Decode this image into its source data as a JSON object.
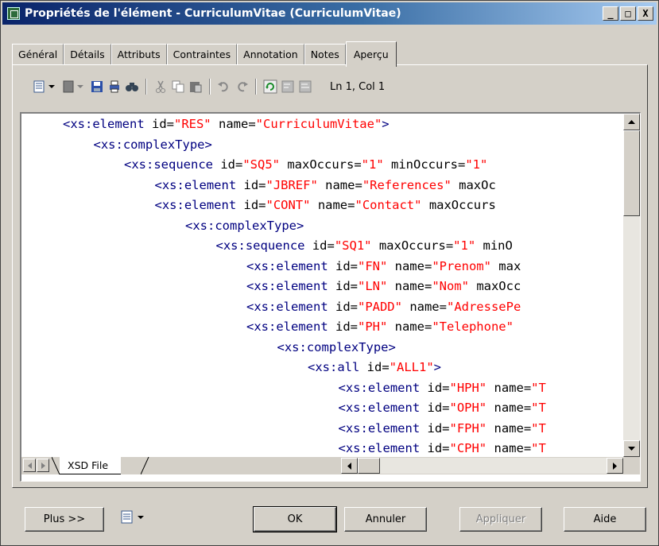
{
  "window": {
    "title": "Propriétés de l'élément - CurriculumVitae (CurriculumVitae)",
    "title_icon": "properties-window-icon",
    "controls": {
      "minimize": "_",
      "maximize": "□",
      "close": "X"
    }
  },
  "tabs": [
    {
      "label": "Général",
      "active": false
    },
    {
      "label": "Détails",
      "active": false
    },
    {
      "label": "Attributs",
      "active": false
    },
    {
      "label": "Contraintes",
      "active": false
    },
    {
      "label": "Annotation",
      "active": false
    },
    {
      "label": "Notes",
      "active": false
    },
    {
      "label": "Aperçu",
      "active": true
    }
  ],
  "toolbar": {
    "icons": [
      "properties-icon",
      "new-icon",
      "save-icon",
      "print-icon",
      "find-icon",
      "cut-icon",
      "copy-icon",
      "paste-icon",
      "undo-icon",
      "redo-icon",
      "refresh-icon",
      "collapse-icon",
      "expand-icon"
    ],
    "position_label": "Ln 1, Col 1"
  },
  "code": {
    "lines": [
      {
        "indent": 0,
        "parts": [
          [
            "t",
            "<xs:element "
          ],
          [
            "a",
            "id="
          ],
          [
            "v",
            "\"RES\""
          ],
          [
            "a",
            " name="
          ],
          [
            "v",
            "\"CurriculumVitae\""
          ],
          [
            "t",
            ">"
          ]
        ]
      },
      {
        "indent": 1,
        "parts": [
          [
            "t",
            "<xs:complexType>"
          ]
        ]
      },
      {
        "indent": 2,
        "parts": [
          [
            "t",
            "<xs:sequence "
          ],
          [
            "a",
            "id="
          ],
          [
            "v",
            "\"SQ5\""
          ],
          [
            "a",
            " maxOccurs="
          ],
          [
            "v",
            "\"1\""
          ],
          [
            "a",
            " minOccurs="
          ],
          [
            "v",
            "\"1\""
          ]
        ]
      },
      {
        "indent": 3,
        "parts": [
          [
            "t",
            "<xs:element "
          ],
          [
            "a",
            "id="
          ],
          [
            "v",
            "\"JBREF\""
          ],
          [
            "a",
            " name="
          ],
          [
            "v",
            "\"References\""
          ],
          [
            "a",
            " maxOc"
          ]
        ]
      },
      {
        "indent": 3,
        "parts": [
          [
            "t",
            "<xs:element "
          ],
          [
            "a",
            "id="
          ],
          [
            "v",
            "\"CONT\""
          ],
          [
            "a",
            " name="
          ],
          [
            "v",
            "\"Contact\""
          ],
          [
            "a",
            " maxOccurs"
          ]
        ]
      },
      {
        "indent": 4,
        "parts": [
          [
            "t",
            "<xs:complexType>"
          ]
        ]
      },
      {
        "indent": 5,
        "parts": [
          [
            "t",
            "<xs:sequence "
          ],
          [
            "a",
            "id="
          ],
          [
            "v",
            "\"SQ1\""
          ],
          [
            "a",
            " maxOccurs="
          ],
          [
            "v",
            "\"1\""
          ],
          [
            "a",
            " minO"
          ]
        ]
      },
      {
        "indent": 6,
        "parts": [
          [
            "t",
            "<xs:element "
          ],
          [
            "a",
            "id="
          ],
          [
            "v",
            "\"FN\""
          ],
          [
            "a",
            " name="
          ],
          [
            "v",
            "\"Prenom\""
          ],
          [
            "a",
            " max"
          ]
        ]
      },
      {
        "indent": 6,
        "parts": [
          [
            "t",
            "<xs:element "
          ],
          [
            "a",
            "id="
          ],
          [
            "v",
            "\"LN\""
          ],
          [
            "a",
            " name="
          ],
          [
            "v",
            "\"Nom\""
          ],
          [
            "a",
            " maxOcc"
          ]
        ]
      },
      {
        "indent": 6,
        "parts": [
          [
            "t",
            "<xs:element "
          ],
          [
            "a",
            "id="
          ],
          [
            "v",
            "\"PADD\""
          ],
          [
            "a",
            " name="
          ],
          [
            "v",
            "\"AdressePe"
          ]
        ]
      },
      {
        "indent": 6,
        "parts": [
          [
            "t",
            "<xs:element "
          ],
          [
            "a",
            "id="
          ],
          [
            "v",
            "\"PH\""
          ],
          [
            "a",
            " name="
          ],
          [
            "v",
            "\"Telephone\""
          ]
        ]
      },
      {
        "indent": 7,
        "parts": [
          [
            "t",
            "<xs:complexType>"
          ]
        ]
      },
      {
        "indent": 8,
        "parts": [
          [
            "t",
            "<xs:all "
          ],
          [
            "a",
            "id="
          ],
          [
            "v",
            "\"ALL1\""
          ],
          [
            "t",
            ">"
          ]
        ]
      },
      {
        "indent": 9,
        "parts": [
          [
            "t",
            "<xs:element "
          ],
          [
            "a",
            "id="
          ],
          [
            "v",
            "\"HPH\""
          ],
          [
            "a",
            " name="
          ],
          [
            "v",
            "\"T"
          ]
        ]
      },
      {
        "indent": 9,
        "parts": [
          [
            "t",
            "<xs:element "
          ],
          [
            "a",
            "id="
          ],
          [
            "v",
            "\"OPH\""
          ],
          [
            "a",
            " name="
          ],
          [
            "v",
            "\"T"
          ]
        ]
      },
      {
        "indent": 9,
        "parts": [
          [
            "t",
            "<xs:element "
          ],
          [
            "a",
            "id="
          ],
          [
            "v",
            "\"FPH\""
          ],
          [
            "a",
            " name="
          ],
          [
            "v",
            "\"T"
          ]
        ]
      },
      {
        "indent": 9,
        "parts": [
          [
            "t",
            "<xs:element "
          ],
          [
            "a",
            "id="
          ],
          [
            "v",
            "\"CPH\""
          ],
          [
            "a",
            " name="
          ],
          [
            "v",
            "\"T"
          ]
        ]
      }
    ],
    "colors": {
      "tag": "#000080",
      "attribute": "#000000",
      "value": "#ff0000"
    }
  },
  "file_tab": {
    "label": "XSD File"
  },
  "buttons": {
    "plus": "Plus >>",
    "ok": "OK",
    "cancel": "Annuler",
    "apply": "Appliquer",
    "help": "Aide"
  }
}
